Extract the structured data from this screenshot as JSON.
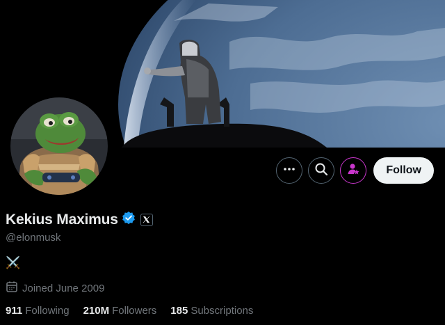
{
  "profile": {
    "display_name": "Kekius Maximus",
    "handle": "@elonmusk",
    "bio": "⚔️",
    "joined": "Joined June 2009",
    "verified": true,
    "affiliation_badge": "x-logo-icon"
  },
  "actions": {
    "more_icon": "more-icon",
    "search_icon": "search-icon",
    "subscribe_icon": "subscribe-icon",
    "follow_label": "Follow"
  },
  "stats": [
    {
      "value": "911",
      "label": "Following"
    },
    {
      "value": "210M",
      "label": "Followers"
    },
    {
      "value": "185",
      "label": "Subscriptions"
    }
  ],
  "colors": {
    "verified": "#1d9bf0",
    "subscribe_accent": "#c936cc",
    "muted_text": "#71767b",
    "primary_text": "#e7e9ea",
    "background": "#000000"
  }
}
